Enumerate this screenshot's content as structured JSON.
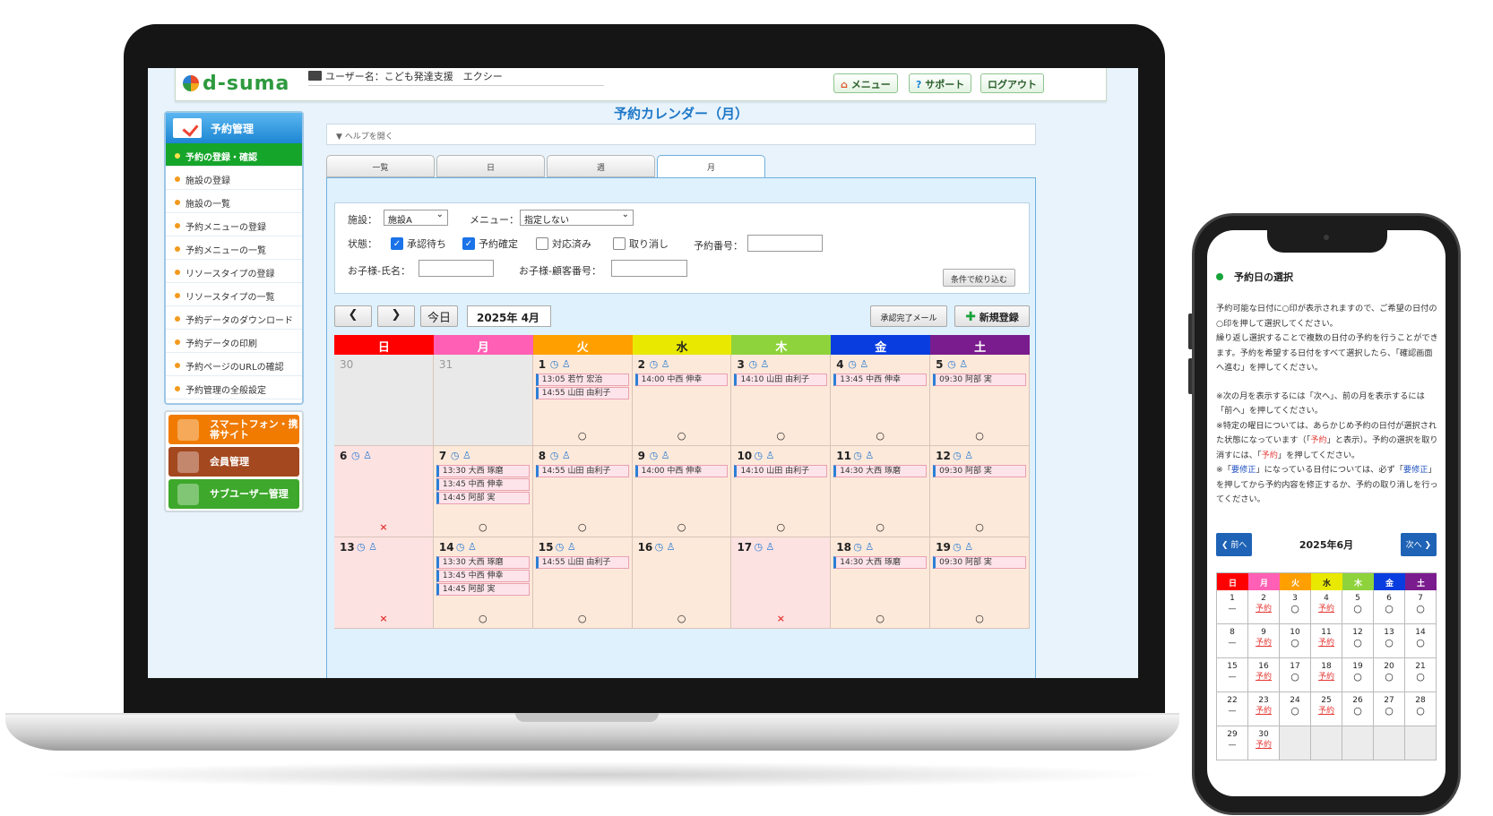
{
  "header": {
    "logo": "d-suma",
    "user_label": "ユーザー名：こども発達支援　エクシー",
    "menu_btn": "メニュー",
    "support_btn": "サポート",
    "logout_btn": "ログアウト"
  },
  "sidebar": {
    "title": "予約管理",
    "items": [
      "予約の登録・確認",
      "施設の登録",
      "施設の一覧",
      "予約メニューの登録",
      "予約メニューの一覧",
      "リソースタイプの登録",
      "リソースタイプの一覧",
      "予約データのダウンロード",
      "予約データの印刷",
      "予約ページのURLの確認",
      "予約管理の全般設定"
    ],
    "buttons": [
      {
        "label": "スマートフォン・携帯サイト",
        "color": "#f07b00"
      },
      {
        "label": "会員管理",
        "color": "#a3481f"
      },
      {
        "label": "サブユーザー管理",
        "color": "#3da82b"
      }
    ]
  },
  "main": {
    "title": "予約カレンダー（月）",
    "help": "▼ ヘルプを開く",
    "tabs": [
      "一覧",
      "日",
      "週",
      "月"
    ],
    "filter": {
      "facility_label": "施設：",
      "facility_value": "施設A",
      "menu_label": "メニュー：",
      "menu_value": "指定しない",
      "status_label": "状態：",
      "statuses": [
        {
          "label": "承認待ち",
          "checked": true
        },
        {
          "label": "予約確定",
          "checked": true
        },
        {
          "label": "対応済み",
          "checked": false
        },
        {
          "label": "取り消し",
          "checked": false
        }
      ],
      "booking_no_label": "予約番号：",
      "child_name_label": "お子様-氏名：",
      "child_no_label": "お子様-顧客番号：",
      "apply_btn": "条件で絞り込む"
    },
    "toolbar": {
      "prev": "❮",
      "next": "❯",
      "today": "今日",
      "month": "2025年 4月",
      "mail_btn": "承認完了メール",
      "new_btn": "新規登録"
    },
    "weekdays": [
      {
        "label": "日",
        "color": "#ff0000"
      },
      {
        "label": "月",
        "color": "#ff5fb4"
      },
      {
        "label": "火",
        "color": "#ff9f00"
      },
      {
        "label": "水",
        "color": "#e8e800"
      },
      {
        "label": "木",
        "color": "#8fd33c"
      },
      {
        "label": "金",
        "color": "#0a3de0"
      },
      {
        "label": "土",
        "color": "#7b1c8e"
      }
    ],
    "weeks": [
      [
        {
          "d": "30",
          "other": true
        },
        {
          "d": "31",
          "other": true
        },
        {
          "d": "1",
          "icons": true,
          "ev": [
            "13:05 若竹 宏治",
            "14:55 山田 由利子"
          ],
          "mark": "○"
        },
        {
          "d": "2",
          "icons": true,
          "ev": [
            "14:00 中西 伸幸"
          ],
          "mark": "○"
        },
        {
          "d": "3",
          "icons": true,
          "ev": [
            "14:10 山田 由利子"
          ],
          "mark": "○"
        },
        {
          "d": "4",
          "icons": true,
          "ev": [
            "13:45 中西 伸幸"
          ],
          "mark": "○"
        },
        {
          "d": "5",
          "icons": true,
          "ev": [
            "09:30 阿部 実"
          ],
          "mark": "○"
        }
      ],
      [
        {
          "d": "6",
          "icons": true,
          "sun": true,
          "ev": [],
          "mark": "×"
        },
        {
          "d": "7",
          "icons": true,
          "ev": [
            "13:30 大西 琢磨",
            "13:45 中西 伸幸",
            "14:45 阿部 実"
          ],
          "mark": "○"
        },
        {
          "d": "8",
          "icons": true,
          "ev": [
            "14:55 山田 由利子"
          ],
          "mark": "○"
        },
        {
          "d": "9",
          "icons": true,
          "ev": [
            "14:00 中西 伸幸"
          ],
          "mark": "○"
        },
        {
          "d": "10",
          "icons": true,
          "ev": [
            "14:10 山田 由利子"
          ],
          "mark": "○"
        },
        {
          "d": "11",
          "icons": true,
          "ev": [
            "14:30 大西 琢磨"
          ],
          "mark": "○"
        },
        {
          "d": "12",
          "icons": true,
          "ev": [
            "09:30 阿部 実"
          ],
          "mark": "○"
        }
      ],
      [
        {
          "d": "13",
          "icons": true,
          "sun": true,
          "ev": [],
          "mark": "×"
        },
        {
          "d": "14",
          "icons": true,
          "ev": [
            "13:30 大西 琢磨",
            "13:45 中西 伸幸",
            "14:45 阿部 実"
          ],
          "mark": "○"
        },
        {
          "d": "15",
          "icons": true,
          "ev": [
            "14:55 山田 由利子"
          ],
          "mark": "○"
        },
        {
          "d": "16",
          "icons": true,
          "ev": [],
          "mark": "○"
        },
        {
          "d": "17",
          "icons": true,
          "sun": true,
          "ev": [],
          "mark": "×"
        },
        {
          "d": "18",
          "icons": true,
          "ev": [
            "14:30 大西 琢磨"
          ],
          "mark": "○"
        },
        {
          "d": "19",
          "icons": true,
          "ev": [
            "09:30 阿部 実"
          ],
          "mark": "○"
        }
      ]
    ]
  },
  "phone": {
    "title": "予約日の選択",
    "para1": "予約可能な日付に○印が表示されますので、ご希望の日付の○印を押して選択してください。",
    "para2": "繰り返し選択することで複数の日付の予約を行うことができます。予約を希望する日付をすべて選択したら、「確認画面へ進む」を押してください。",
    "note1": "※次の月を表示するには「次へ」、前の月を表示するには「前へ」を押してください。",
    "note2a": "※特定の曜日については、あらかじめ予約の日付が選択された状態になっています（「",
    "note2b": "予約",
    "note2c": "」と表示）。予約の選択を取り消すには、「",
    "note2d": "予約",
    "note2e": "」を押してください。",
    "note3a": "※「",
    "note3b": "要修正",
    "note3c": "」になっている日付については、必ず「",
    "note3d": "要修正",
    "note3e": "」を押してから予約内容を修正するか、予約の取り消しを行ってください。",
    "prev": "❮ 前へ",
    "next": "次へ ❯",
    "month": "2025年6月",
    "weekdays": [
      {
        "label": "日",
        "color": "#ff0000"
      },
      {
        "label": "月",
        "color": "#ff5fb4"
      },
      {
        "label": "火",
        "color": "#ff9f00"
      },
      {
        "label": "水",
        "color": "#e8e800"
      },
      {
        "label": "木",
        "color": "#8fd33c"
      },
      {
        "label": "金",
        "color": "#0a3de0"
      },
      {
        "label": "土",
        "color": "#7b1c8e"
      }
    ],
    "weeks": [
      [
        [
          "1",
          "—"
        ],
        [
          "2",
          "予約"
        ],
        [
          "3",
          "○"
        ],
        [
          "4",
          "予約"
        ],
        [
          "5",
          "○"
        ],
        [
          "6",
          "○"
        ],
        [
          "7",
          "○"
        ]
      ],
      [
        [
          "8",
          "—"
        ],
        [
          "9",
          "予約"
        ],
        [
          "10",
          "○"
        ],
        [
          "11",
          "予約"
        ],
        [
          "12",
          "○"
        ],
        [
          "13",
          "○"
        ],
        [
          "14",
          "○"
        ]
      ],
      [
        [
          "15",
          "—"
        ],
        [
          "16",
          "予約"
        ],
        [
          "17",
          "○"
        ],
        [
          "18",
          "予約"
        ],
        [
          "19",
          "○"
        ],
        [
          "20",
          "○"
        ],
        [
          "21",
          "○"
        ]
      ],
      [
        [
          "22",
          "—"
        ],
        [
          "23",
          "予約"
        ],
        [
          "24",
          "○"
        ],
        [
          "25",
          "予約"
        ],
        [
          "26",
          "○"
        ],
        [
          "27",
          "○"
        ],
        [
          "28",
          "○"
        ]
      ],
      [
        [
          "29",
          "—"
        ],
        [
          "30",
          "予約"
        ],
        null,
        null,
        null,
        null,
        null
      ]
    ]
  }
}
